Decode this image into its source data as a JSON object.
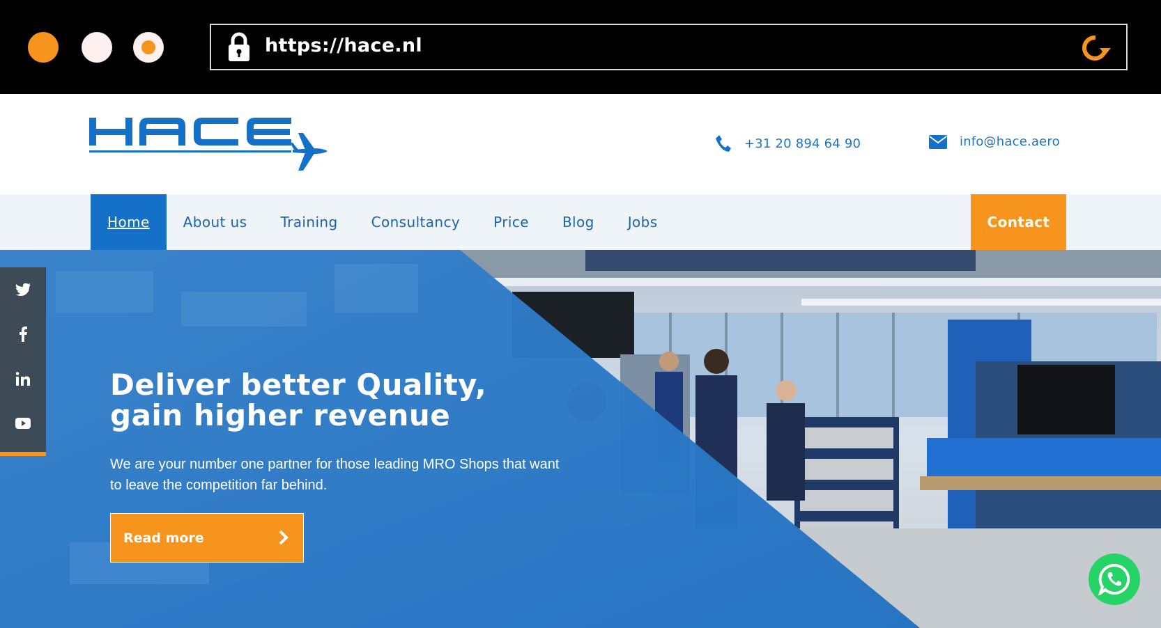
{
  "browser": {
    "url": "https://hace.nl"
  },
  "header": {
    "logo_text": "HACE",
    "phone": "+31 20 894 64 90",
    "email": "info@hace.aero"
  },
  "nav": {
    "items": [
      {
        "label": "Home",
        "active": true
      },
      {
        "label": "About us"
      },
      {
        "label": "Training"
      },
      {
        "label": "Consultancy"
      },
      {
        "label": "Price"
      },
      {
        "label": "Blog"
      },
      {
        "label": "Jobs"
      }
    ],
    "contact_label": "Contact"
  },
  "social": {
    "items": [
      {
        "icon": "twitter-icon",
        "glyph": "🐦"
      },
      {
        "icon": "facebook-icon",
        "glyph": "f"
      },
      {
        "icon": "linkedin-icon",
        "glyph": "in"
      },
      {
        "icon": "youtube-icon",
        "glyph": "▶"
      }
    ]
  },
  "hero": {
    "title_line1": "Deliver better Quality,",
    "title_line2": "gain higher revenue",
    "subtitle": "We are your number one partner for those leading MRO Shops that want to leave the competition far behind.",
    "cta_label": "Read more"
  },
  "colors": {
    "brand_blue": "#1570c7",
    "accent_orange": "#f7941d",
    "whatsapp_green": "#25d366"
  }
}
